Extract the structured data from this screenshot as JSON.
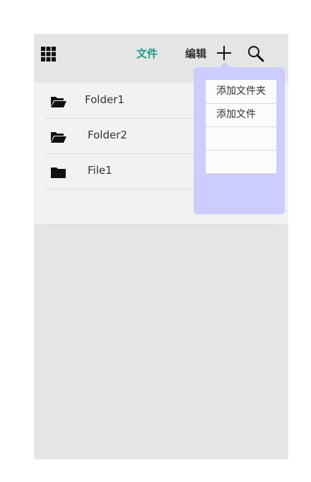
{
  "header": {
    "tabs": [
      {
        "label": "文件",
        "active": true
      },
      {
        "label": "编辑",
        "active": false
      }
    ],
    "icons": [
      "grid-menu-icon",
      "plus-icon",
      "search-icon"
    ],
    "active_color": "#1a9a8a"
  },
  "file_list": {
    "items": [
      {
        "name": "Folder1",
        "icon": "folder-open-icon"
      },
      {
        "name": "Folder2",
        "icon": "folder-open-icon"
      },
      {
        "name": "File1",
        "icon": "folder-closed-icon"
      }
    ]
  },
  "add_menu": {
    "items": [
      {
        "label": "添加文件夹"
      },
      {
        "label": "添加文件"
      },
      {
        "label": ""
      },
      {
        "label": ""
      }
    ],
    "background_color": "#ccccff"
  }
}
